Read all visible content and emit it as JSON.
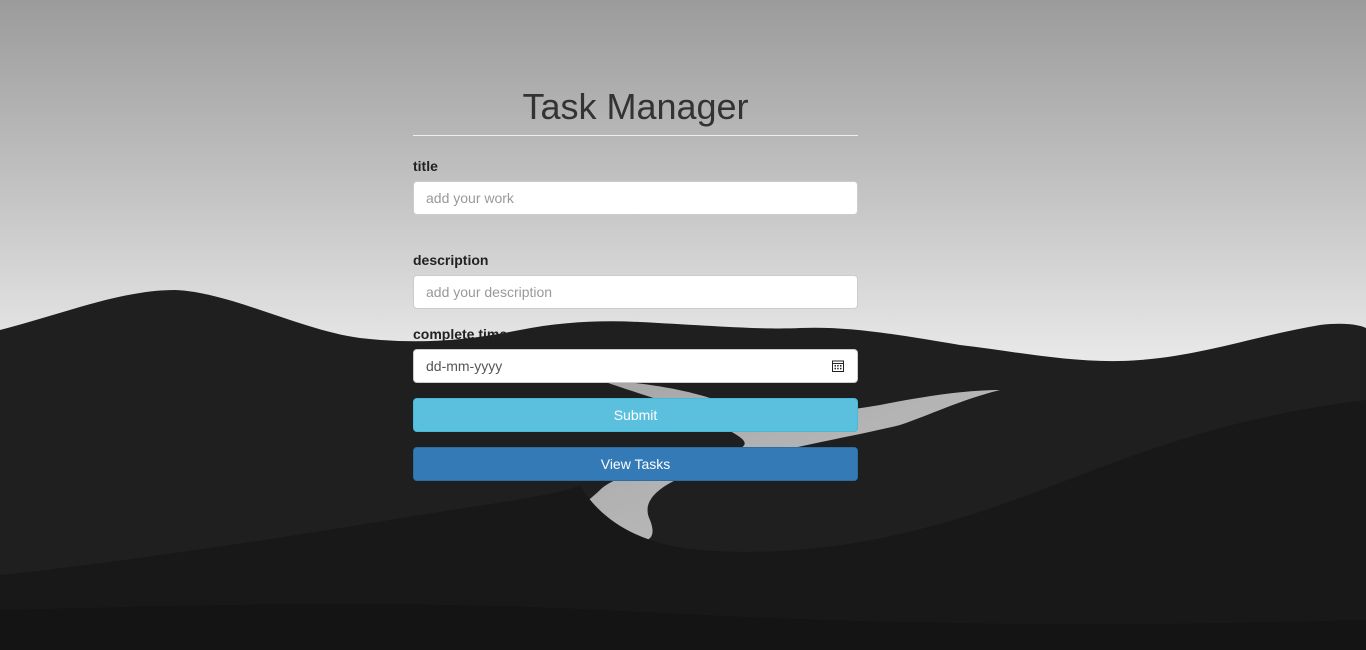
{
  "header": {
    "title": "Task Manager"
  },
  "form": {
    "title_field": {
      "label": "title",
      "placeholder": "add your work",
      "value": ""
    },
    "description_field": {
      "label": "description",
      "placeholder": "add your description",
      "value": ""
    },
    "complete_time_field": {
      "label": "complete time",
      "placeholder": "dd-mm-yyyy",
      "icon": "calendar-icon"
    },
    "submit_label": "Submit",
    "view_tasks_label": "View Tasks"
  },
  "colors": {
    "submit_button": "#5bc0de",
    "view_tasks_button": "#337ab7",
    "title_text": "#333333"
  }
}
